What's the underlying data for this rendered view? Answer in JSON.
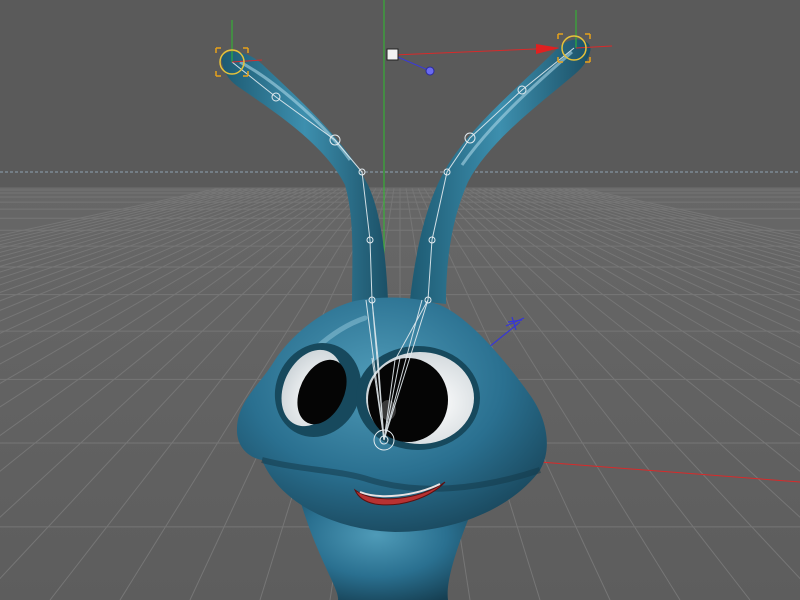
{
  "viewport": {
    "label": "",
    "colors": {
      "background": "#5a5a5a",
      "floor": "#5f5f5f",
      "grid_line": "#777777",
      "horizon": "#8da0ad",
      "axis_y": "#2fbf2f",
      "axis_x": "#e02020",
      "axis_z": "#3b3bd6",
      "character_skin": "#2f7590",
      "character_skin_dark": "#184a5e",
      "character_highlight": "#9fd0e2",
      "eye_white": "#ffffff",
      "pupil": "#050505",
      "mouth": "#c23a3a",
      "rig_lines": "#e8eef2",
      "handle_ring": "#e6c23a"
    },
    "icons": {
      "move_handle": "move-handle-icon",
      "null_object": "null-object-icon",
      "light": "light-icon",
      "camera_target": "camera-target-icon"
    }
  }
}
